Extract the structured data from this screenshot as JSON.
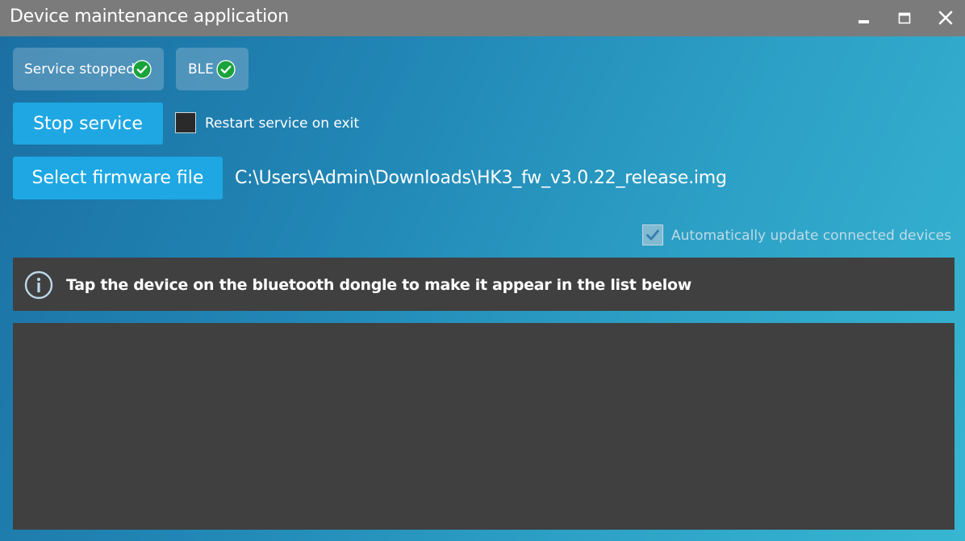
{
  "window": {
    "title": "Device maintenance application",
    "controls": {
      "minimize": "minimize-icon",
      "maximize": "maximize-icon",
      "close": "close-icon"
    }
  },
  "status": {
    "service": {
      "label": "Service stopped",
      "ok": true,
      "icon": "check-circle-icon"
    },
    "ble": {
      "label": "BLE",
      "ok": true,
      "icon": "check-circle-icon"
    }
  },
  "controls": {
    "stop_service_label": "Stop service",
    "restart_on_exit_label": "Restart service on exit",
    "restart_on_exit_checked": false,
    "select_firmware_label": "Select firmware file",
    "firmware_path": "C:\\Users\\Admin\\Downloads\\HK3_fw_v3.0.22_release.img",
    "auto_update_label": "Automatically update connected devices",
    "auto_update_checked": true,
    "auto_update_enabled": false
  },
  "info": {
    "icon": "info-icon",
    "message": "Tap the device on the bluetooth dongle to make it appear in the list below"
  },
  "device_list": {
    "items": []
  },
  "colors": {
    "accent": "#1ea7e3",
    "success": "#1aa33a",
    "panel": "#404040",
    "titlebar": "#7b7b7b"
  }
}
